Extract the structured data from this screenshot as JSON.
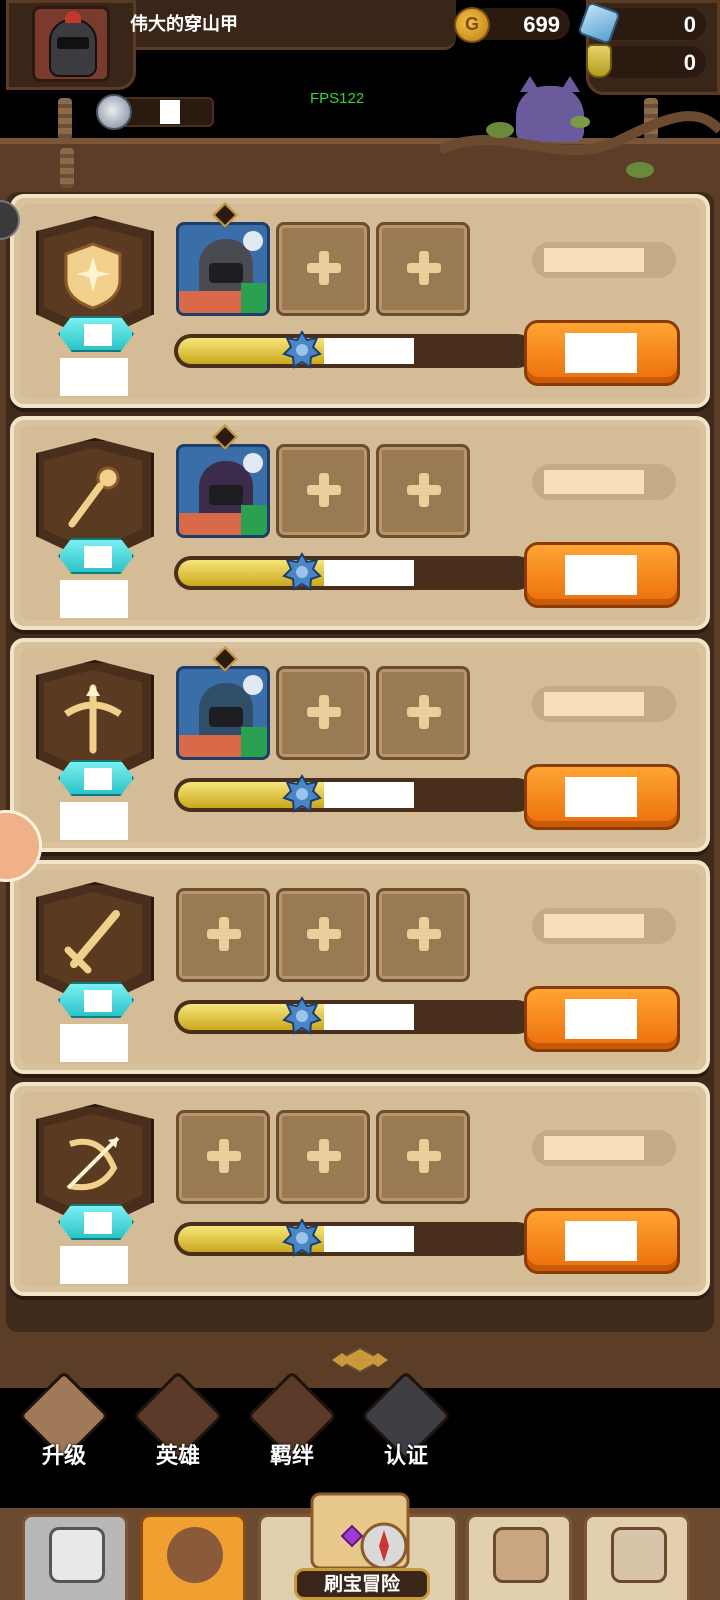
{
  "player": {
    "name": "伟大的穿山甲"
  },
  "resources": {
    "gold": "699",
    "gems": "0",
    "potions": "0"
  },
  "debug": {
    "fps": "FPS122"
  },
  "colors": {
    "accent": "#ec6e0c",
    "gem_badge": "#2bc4c8",
    "board": "#5b3d28",
    "row_bg": "#d9c29e"
  },
  "class_rows": [
    {
      "class_icon": "shield-icon",
      "hero": {
        "present": true,
        "element_icon": "wind-icon",
        "role_icon": "shield-role-icon",
        "head_color": "#4a4a52",
        "bg": "#3a6ea8"
      },
      "slot_count_empty": 2,
      "progress": 0.62
    },
    {
      "class_icon": "staff-icon",
      "hero": {
        "present": true,
        "element_icon": "fire-icon",
        "role_icon": "staff-role-icon",
        "head_color": "#3a2c4a",
        "bg": "#3a6ea8"
      },
      "slot_count_empty": 2,
      "progress": 0.62
    },
    {
      "class_icon": "crossbow-icon",
      "hero": {
        "present": true,
        "element_icon": "water-icon",
        "role_icon": "crossbow-role-icon",
        "head_color": "#2e4e6a",
        "bg": "#3a6ea8"
      },
      "slot_count_empty": 2,
      "progress": 0.62
    },
    {
      "class_icon": "sword-icon",
      "hero": {
        "present": false
      },
      "slot_count_empty": 3,
      "progress": 0.62
    },
    {
      "class_icon": "bow-icon",
      "hero": {
        "present": false
      },
      "slot_count_empty": 3,
      "progress": 0.62
    }
  ],
  "subnav": [
    {
      "label": "升级",
      "icon": "upgrade-icon",
      "active": true
    },
    {
      "label": "英雄",
      "icon": "hero-icon",
      "active": false
    },
    {
      "label": "羁绊",
      "icon": "bond-icon",
      "active": false
    },
    {
      "label": "认证",
      "icon": "certify-icon",
      "active": false
    }
  ],
  "bottom_nav": {
    "adventure_label": "刷宝冒险",
    "tabs": [
      {
        "icon": "shop-icon"
      },
      {
        "icon": "heroes-tab-icon",
        "active": true
      },
      {
        "icon": "adventure-map-icon"
      },
      {
        "icon": "backpack-icon"
      },
      {
        "icon": "forge-icon"
      }
    ]
  }
}
